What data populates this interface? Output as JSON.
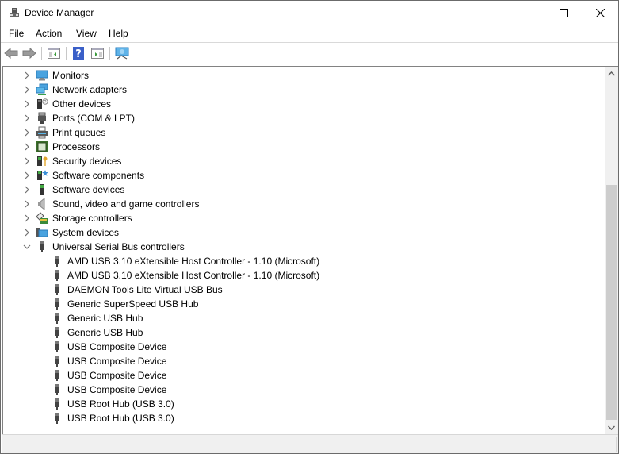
{
  "window": {
    "title": "Device Manager",
    "controls": {
      "minimize": "minimize",
      "maximize": "maximize",
      "close": "close"
    }
  },
  "menu": [
    "File",
    "Action",
    "View",
    "Help"
  ],
  "toolbar": [
    {
      "name": "back-button",
      "icon": "arrow-left-icon"
    },
    {
      "name": "forward-button",
      "icon": "arrow-right-icon"
    },
    {
      "name": "show-hide-console-tree-button",
      "icon": "console-tree-icon"
    },
    {
      "name": "help-button",
      "icon": "help-icon"
    },
    {
      "name": "show-hide-action-pane-button",
      "icon": "action-pane-icon"
    },
    {
      "name": "scan-hardware-button",
      "icon": "monitor-scan-icon"
    }
  ],
  "tree": {
    "categories": [
      {
        "label": "Monitors",
        "icon": "monitor-icon",
        "expanded": false
      },
      {
        "label": "Network adapters",
        "icon": "network-icon",
        "expanded": false
      },
      {
        "label": "Other devices",
        "icon": "unknown-device-icon",
        "expanded": false
      },
      {
        "label": "Ports (COM & LPT)",
        "icon": "port-icon",
        "expanded": false
      },
      {
        "label": "Print queues",
        "icon": "printer-icon",
        "expanded": false
      },
      {
        "label": "Processors",
        "icon": "processor-icon",
        "expanded": false
      },
      {
        "label": "Security devices",
        "icon": "security-device-icon",
        "expanded": false
      },
      {
        "label": "Software components",
        "icon": "software-component-icon",
        "expanded": false
      },
      {
        "label": "Software devices",
        "icon": "software-device-icon",
        "expanded": false
      },
      {
        "label": "Sound, video and game controllers",
        "icon": "speaker-icon",
        "expanded": false
      },
      {
        "label": "Storage controllers",
        "icon": "storage-controller-icon",
        "expanded": false
      },
      {
        "label": "System devices",
        "icon": "system-device-icon",
        "expanded": false
      },
      {
        "label": "Universal Serial Bus controllers",
        "icon": "usb-icon",
        "expanded": true
      }
    ],
    "usb_children": [
      "AMD USB 3.10 eXtensible Host Controller - 1.10 (Microsoft)",
      "AMD USB 3.10 eXtensible Host Controller - 1.10 (Microsoft)",
      "DAEMON Tools Lite Virtual USB Bus",
      "Generic SuperSpeed USB Hub",
      "Generic USB Hub",
      "Generic USB Hub",
      "USB Composite Device",
      "USB Composite Device",
      "USB Composite Device",
      "USB Composite Device",
      "USB Root Hub (USB 3.0)",
      "USB Root Hub (USB 3.0)"
    ]
  },
  "scrollbar": {
    "position_fraction": 1.0
  }
}
